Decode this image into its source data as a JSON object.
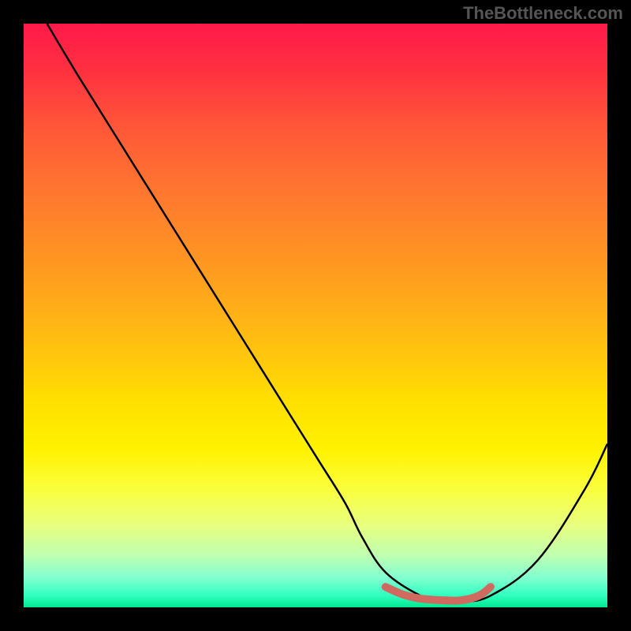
{
  "watermark": "TheBottleneck.com",
  "chart_data": {
    "type": "line",
    "title": "",
    "xlabel": "",
    "ylabel": "",
    "xlim": [
      0,
      100
    ],
    "ylim": [
      0,
      100
    ],
    "series": [
      {
        "name": "main-curve",
        "color": "#000000",
        "x": [
          4,
          10,
          20,
          30,
          40,
          50,
          55,
          58,
          62,
          68,
          72,
          75,
          80,
          88,
          96,
          100
        ],
        "y": [
          100,
          90,
          74,
          58,
          42,
          26,
          18,
          12,
          6,
          2,
          1,
          1,
          2,
          8,
          20,
          28
        ]
      },
      {
        "name": "highlight-segment",
        "color": "#d06a60",
        "x": [
          62,
          65,
          68,
          72,
          75,
          78,
          80
        ],
        "y": [
          3.5,
          2.2,
          1.5,
          1.2,
          1.2,
          2,
          3.5
        ]
      }
    ],
    "gradient_stops": [
      {
        "pos": 0,
        "color": "#ff1a4a"
      },
      {
        "pos": 50,
        "color": "#ffc010"
      },
      {
        "pos": 75,
        "color": "#fff200"
      },
      {
        "pos": 100,
        "color": "#00e890"
      }
    ]
  }
}
